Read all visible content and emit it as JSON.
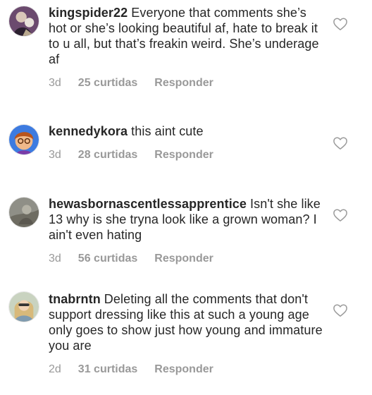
{
  "comments": [
    {
      "username": "kingspider22",
      "text": "Everyone that comments she’s hot or she’s looking beautiful af, hate to break it to u all, but that’s freakin weird. She’s underage af",
      "time": "3d",
      "likes": "25 curtidas",
      "reply": "Responder",
      "avatar_icon": "user-avatar-icon",
      "heart_icon": "heart-outline-icon"
    },
    {
      "username": "kennedykora",
      "text": "this aint cute",
      "time": "3d",
      "likes": "28 curtidas",
      "reply": "Responder",
      "avatar_icon": "user-avatar-icon",
      "heart_icon": "heart-outline-icon"
    },
    {
      "username": "hewasbornascentlessapprentice",
      "text": "Isn't she like 13 why is she tryna look like a grown woman? I ain't even hating",
      "time": "3d",
      "likes": "56 curtidas",
      "reply": "Responder",
      "avatar_icon": "user-avatar-icon",
      "heart_icon": "heart-outline-icon"
    },
    {
      "username": "tnabrntn",
      "text": "Deleting all the comments that don't support dressing like this at such a young age only goes to show just how young and immature you are",
      "time": "2d",
      "likes": "31 curtidas",
      "reply": "Responder",
      "avatar_icon": "user-avatar-icon",
      "heart_icon": "heart-outline-icon"
    }
  ],
  "colors": {
    "text": "#262626",
    "meta": "#999999",
    "heart_stroke": "#999999"
  }
}
